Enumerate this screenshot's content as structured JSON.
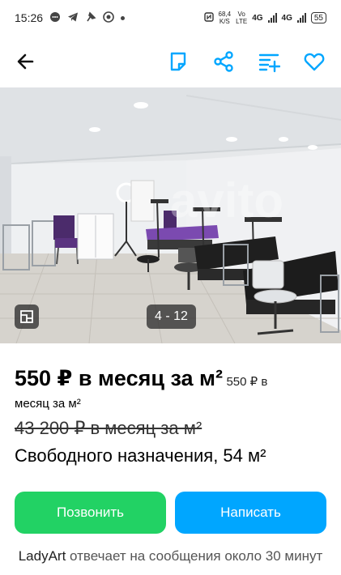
{
  "status_bar": {
    "time": "15:26",
    "speed_value": "68,4",
    "speed_unit": "K/S",
    "volte_top": "Vo",
    "volte_bottom": "LTE",
    "net1": "4G",
    "net2": "4G",
    "battery": "55"
  },
  "app_bar": {
    "icons": [
      "back-arrow-icon",
      "note-icon",
      "share-icon",
      "compare-icon",
      "favorite-icon"
    ],
    "accent": "#00a6ff"
  },
  "gallery": {
    "counter": "4 - 12"
  },
  "listing": {
    "price_main": "550 ₽ в месяц за м²",
    "price_secondary": "550 ₽ в месяц за м²",
    "old_price": "43 200 ₽ в месяц за м²",
    "title": "Свободного назначения, 54 м²"
  },
  "actions": {
    "call_label": "Позвонить",
    "call_color": "#22d264",
    "write_label": "Написать",
    "write_color": "#00a6ff"
  },
  "seller": {
    "name": "LadyArt",
    "response_text": "отвечает на сообщения около 30 минут"
  }
}
